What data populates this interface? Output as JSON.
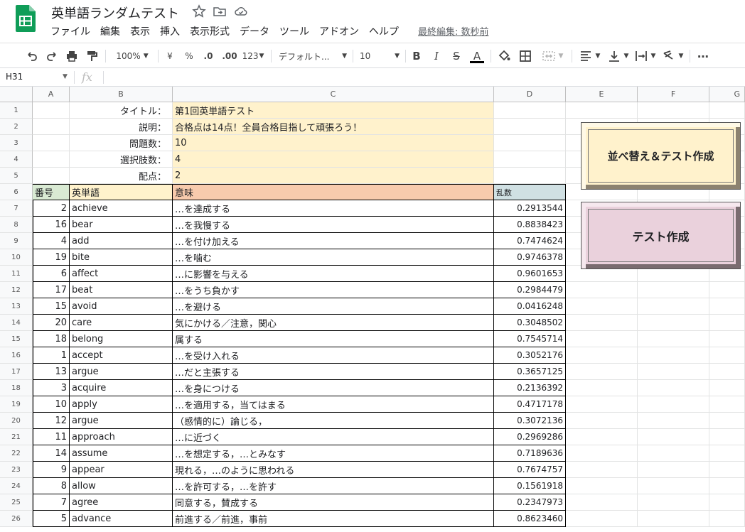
{
  "doc": {
    "title": "英単語ランダムテスト",
    "last_edit": "最終編集: 数秒前"
  },
  "menu": [
    "ファイル",
    "編集",
    "表示",
    "挿入",
    "表示形式",
    "データ",
    "ツール",
    "アドオン",
    "ヘルプ"
  ],
  "toolbar": {
    "zoom": "100%",
    "currency": "¥",
    "percent": "%",
    "dec_decrease": ".0",
    "dec_increase": ".00",
    "format": "123",
    "font": "デフォルト...",
    "font_size": "10"
  },
  "formula": {
    "cell_ref": "H31",
    "fx": "fx"
  },
  "columns": [
    "A",
    "B",
    "C",
    "D",
    "E",
    "F",
    "G"
  ],
  "rows": [
    "1",
    "2",
    "3",
    "4",
    "5",
    "6",
    "7",
    "8",
    "9",
    "10",
    "11",
    "12",
    "13",
    "14",
    "15",
    "16",
    "17",
    "18",
    "19",
    "20",
    "21",
    "22",
    "23",
    "24",
    "25",
    "26"
  ],
  "meta": [
    {
      "label": "タイトル：",
      "value": "第1回英単語テスト"
    },
    {
      "label": "説明：",
      "value": "合格点は14点！全員合格目指して頑張ろう！"
    },
    {
      "label": "問題数：",
      "value": "10"
    },
    {
      "label": "選択肢数：",
      "value": "4"
    },
    {
      "label": "配点：",
      "value": "2"
    }
  ],
  "table_headers": {
    "num": "番号",
    "word": "英単語",
    "meaning": "意味",
    "rand": "乱数"
  },
  "table_rows": [
    {
      "num": "2",
      "word": "achieve",
      "meaning": "…を達成する",
      "rand": "0.2913544"
    },
    {
      "num": "16",
      "word": "bear",
      "meaning": "…を我慢する",
      "rand": "0.8838423"
    },
    {
      "num": "4",
      "word": "add",
      "meaning": "…を付け加える",
      "rand": "0.7474624"
    },
    {
      "num": "19",
      "word": "bite",
      "meaning": "…を噛む",
      "rand": "0.9746378"
    },
    {
      "num": "6",
      "word": "affect",
      "meaning": "…に影響を与える",
      "rand": "0.9601653"
    },
    {
      "num": "17",
      "word": "beat",
      "meaning": "…をうち負かす",
      "rand": "0.2984479"
    },
    {
      "num": "15",
      "word": "avoid",
      "meaning": "…を避ける",
      "rand": "0.0416248"
    },
    {
      "num": "20",
      "word": "care",
      "meaning": "気にかける／注意，関心",
      "rand": "0.3048502"
    },
    {
      "num": "18",
      "word": "belong",
      "meaning": "属する",
      "rand": "0.7545714"
    },
    {
      "num": "1",
      "word": "accept",
      "meaning": "…を受け入れる",
      "rand": "0.3052176"
    },
    {
      "num": "13",
      "word": "argue",
      "meaning": "…だと主張する",
      "rand": "0.3657125"
    },
    {
      "num": "3",
      "word": "acquire",
      "meaning": "…を身につける",
      "rand": "0.2136392"
    },
    {
      "num": "10",
      "word": "apply",
      "meaning": "…を適用する，当てはまる",
      "rand": "0.4717178"
    },
    {
      "num": "12",
      "word": "argue",
      "meaning": "（感情的に）論じる，",
      "rand": "0.3072136"
    },
    {
      "num": "11",
      "word": "approach",
      "meaning": "…に近づく",
      "rand": "0.2969286"
    },
    {
      "num": "14",
      "word": "assume",
      "meaning": "…を想定する，…とみなす",
      "rand": "0.7189636"
    },
    {
      "num": "9",
      "word": "appear",
      "meaning": "現れる，…のように思われる",
      "rand": "0.7674757"
    },
    {
      "num": "8",
      "word": "allow",
      "meaning": "…を許可する，…を許す",
      "rand": "0.1561918"
    },
    {
      "num": "7",
      "word": "agree",
      "meaning": "同意する，賛成する",
      "rand": "0.2347973"
    },
    {
      "num": "5",
      "word": "advance",
      "meaning": "前進する／前進，事前",
      "rand": "0.8623460"
    }
  ],
  "buttons": {
    "sort": "並べ替え＆テスト作成",
    "test": "テスト作成"
  },
  "colors": {
    "meta_bg": "#fff2cc",
    "num_bg": "#d9ead3",
    "meaning_bg": "#f8cbad",
    "rand_bg": "#d0e0e3",
    "sort_btn": "#fff2cc",
    "test_btn": "#ead1dc"
  }
}
